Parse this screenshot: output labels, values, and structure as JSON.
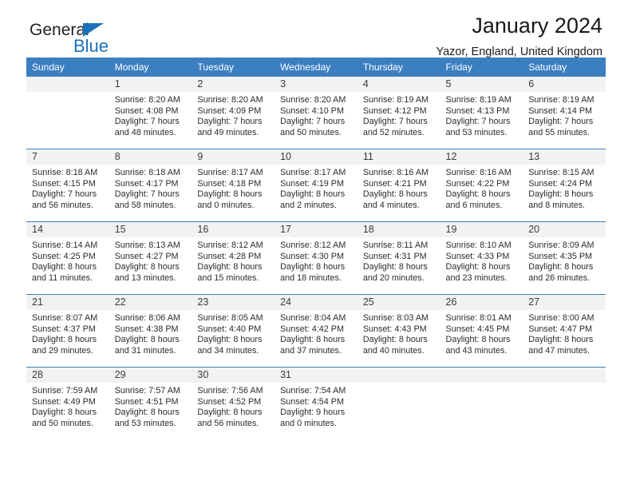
{
  "brand": {
    "name_dark": "General",
    "name_blue": "Blue",
    "accent_color": "#1b72b8"
  },
  "header": {
    "title": "January 2024",
    "subtitle": "Yazor, England, United Kingdom"
  },
  "calendar": {
    "header_bg": "#3c7fc1",
    "daynum_bg": "#f2f2f2",
    "weekdays": [
      "Sunday",
      "Monday",
      "Tuesday",
      "Wednesday",
      "Thursday",
      "Friday",
      "Saturday"
    ],
    "weeks": [
      [
        {
          "day": "",
          "lines": []
        },
        {
          "day": "1",
          "lines": [
            "Sunrise: 8:20 AM",
            "Sunset: 4:08 PM",
            "Daylight: 7 hours",
            "and 48 minutes."
          ]
        },
        {
          "day": "2",
          "lines": [
            "Sunrise: 8:20 AM",
            "Sunset: 4:09 PM",
            "Daylight: 7 hours",
            "and 49 minutes."
          ]
        },
        {
          "day": "3",
          "lines": [
            "Sunrise: 8:20 AM",
            "Sunset: 4:10 PM",
            "Daylight: 7 hours",
            "and 50 minutes."
          ]
        },
        {
          "day": "4",
          "lines": [
            "Sunrise: 8:19 AM",
            "Sunset: 4:12 PM",
            "Daylight: 7 hours",
            "and 52 minutes."
          ]
        },
        {
          "day": "5",
          "lines": [
            "Sunrise: 8:19 AM",
            "Sunset: 4:13 PM",
            "Daylight: 7 hours",
            "and 53 minutes."
          ]
        },
        {
          "day": "6",
          "lines": [
            "Sunrise: 8:19 AM",
            "Sunset: 4:14 PM",
            "Daylight: 7 hours",
            "and 55 minutes."
          ]
        }
      ],
      [
        {
          "day": "7",
          "lines": [
            "Sunrise: 8:18 AM",
            "Sunset: 4:15 PM",
            "Daylight: 7 hours",
            "and 56 minutes."
          ]
        },
        {
          "day": "8",
          "lines": [
            "Sunrise: 8:18 AM",
            "Sunset: 4:17 PM",
            "Daylight: 7 hours",
            "and 58 minutes."
          ]
        },
        {
          "day": "9",
          "lines": [
            "Sunrise: 8:17 AM",
            "Sunset: 4:18 PM",
            "Daylight: 8 hours",
            "and 0 minutes."
          ]
        },
        {
          "day": "10",
          "lines": [
            "Sunrise: 8:17 AM",
            "Sunset: 4:19 PM",
            "Daylight: 8 hours",
            "and 2 minutes."
          ]
        },
        {
          "day": "11",
          "lines": [
            "Sunrise: 8:16 AM",
            "Sunset: 4:21 PM",
            "Daylight: 8 hours",
            "and 4 minutes."
          ]
        },
        {
          "day": "12",
          "lines": [
            "Sunrise: 8:16 AM",
            "Sunset: 4:22 PM",
            "Daylight: 8 hours",
            "and 6 minutes."
          ]
        },
        {
          "day": "13",
          "lines": [
            "Sunrise: 8:15 AM",
            "Sunset: 4:24 PM",
            "Daylight: 8 hours",
            "and 8 minutes."
          ]
        }
      ],
      [
        {
          "day": "14",
          "lines": [
            "Sunrise: 8:14 AM",
            "Sunset: 4:25 PM",
            "Daylight: 8 hours",
            "and 11 minutes."
          ]
        },
        {
          "day": "15",
          "lines": [
            "Sunrise: 8:13 AM",
            "Sunset: 4:27 PM",
            "Daylight: 8 hours",
            "and 13 minutes."
          ]
        },
        {
          "day": "16",
          "lines": [
            "Sunrise: 8:12 AM",
            "Sunset: 4:28 PM",
            "Daylight: 8 hours",
            "and 15 minutes."
          ]
        },
        {
          "day": "17",
          "lines": [
            "Sunrise: 8:12 AM",
            "Sunset: 4:30 PM",
            "Daylight: 8 hours",
            "and 18 minutes."
          ]
        },
        {
          "day": "18",
          "lines": [
            "Sunrise: 8:11 AM",
            "Sunset: 4:31 PM",
            "Daylight: 8 hours",
            "and 20 minutes."
          ]
        },
        {
          "day": "19",
          "lines": [
            "Sunrise: 8:10 AM",
            "Sunset: 4:33 PM",
            "Daylight: 8 hours",
            "and 23 minutes."
          ]
        },
        {
          "day": "20",
          "lines": [
            "Sunrise: 8:09 AM",
            "Sunset: 4:35 PM",
            "Daylight: 8 hours",
            "and 26 minutes."
          ]
        }
      ],
      [
        {
          "day": "21",
          "lines": [
            "Sunrise: 8:07 AM",
            "Sunset: 4:37 PM",
            "Daylight: 8 hours",
            "and 29 minutes."
          ]
        },
        {
          "day": "22",
          "lines": [
            "Sunrise: 8:06 AM",
            "Sunset: 4:38 PM",
            "Daylight: 8 hours",
            "and 31 minutes."
          ]
        },
        {
          "day": "23",
          "lines": [
            "Sunrise: 8:05 AM",
            "Sunset: 4:40 PM",
            "Daylight: 8 hours",
            "and 34 minutes."
          ]
        },
        {
          "day": "24",
          "lines": [
            "Sunrise: 8:04 AM",
            "Sunset: 4:42 PM",
            "Daylight: 8 hours",
            "and 37 minutes."
          ]
        },
        {
          "day": "25",
          "lines": [
            "Sunrise: 8:03 AM",
            "Sunset: 4:43 PM",
            "Daylight: 8 hours",
            "and 40 minutes."
          ]
        },
        {
          "day": "26",
          "lines": [
            "Sunrise: 8:01 AM",
            "Sunset: 4:45 PM",
            "Daylight: 8 hours",
            "and 43 minutes."
          ]
        },
        {
          "day": "27",
          "lines": [
            "Sunrise: 8:00 AM",
            "Sunset: 4:47 PM",
            "Daylight: 8 hours",
            "and 47 minutes."
          ]
        }
      ],
      [
        {
          "day": "28",
          "lines": [
            "Sunrise: 7:59 AM",
            "Sunset: 4:49 PM",
            "Daylight: 8 hours",
            "and 50 minutes."
          ]
        },
        {
          "day": "29",
          "lines": [
            "Sunrise: 7:57 AM",
            "Sunset: 4:51 PM",
            "Daylight: 8 hours",
            "and 53 minutes."
          ]
        },
        {
          "day": "30",
          "lines": [
            "Sunrise: 7:56 AM",
            "Sunset: 4:52 PM",
            "Daylight: 8 hours",
            "and 56 minutes."
          ]
        },
        {
          "day": "31",
          "lines": [
            "Sunrise: 7:54 AM",
            "Sunset: 4:54 PM",
            "Daylight: 9 hours",
            "and 0 minutes."
          ]
        },
        {
          "day": "",
          "lines": []
        },
        {
          "day": "",
          "lines": []
        },
        {
          "day": "",
          "lines": []
        }
      ]
    ]
  }
}
